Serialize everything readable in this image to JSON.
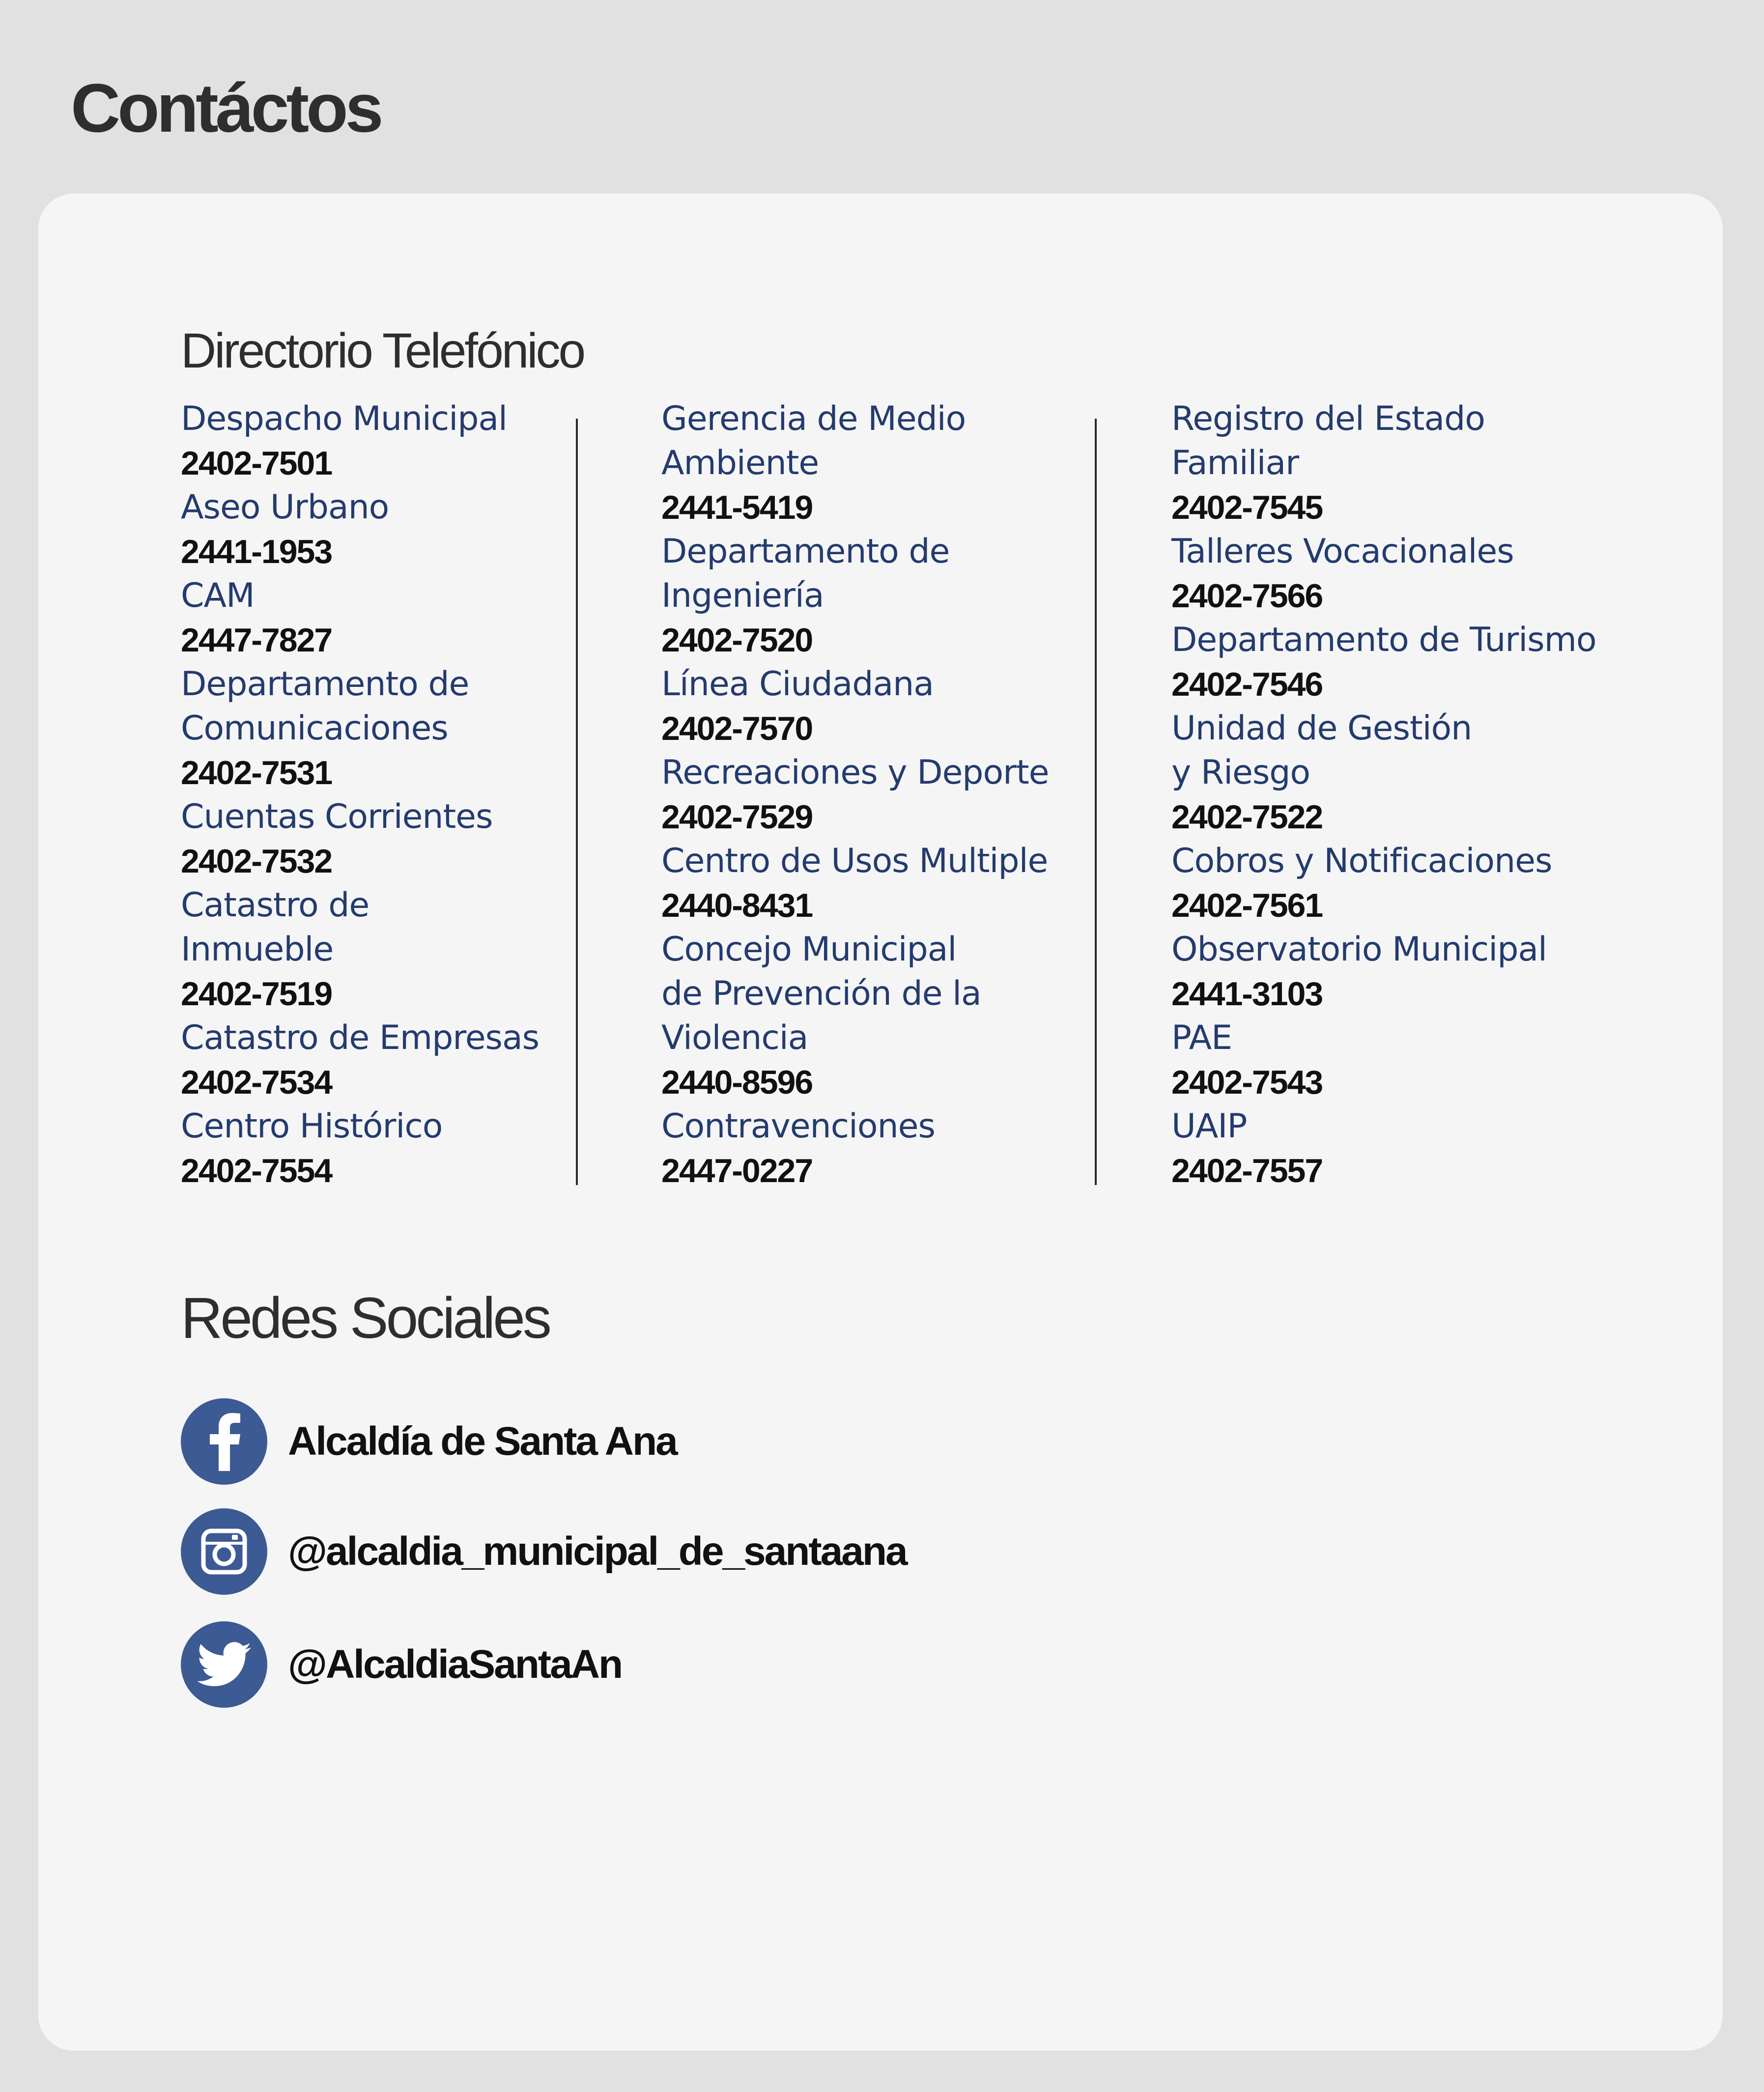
{
  "page": {
    "title": "Contáctos"
  },
  "directory": {
    "title": "Directorio Telefónico",
    "columns": [
      [
        {
          "name": "Despacho Municipal",
          "phone": "2402-7501"
        },
        {
          "name": "Aseo Urbano",
          "phone": "2441-1953"
        },
        {
          "name": "CAM",
          "phone": "2447-7827"
        },
        {
          "name": "Departamento de\nComunicaciones",
          "phone": "2402-7531"
        },
        {
          "name": "Cuentas Corrientes",
          "phone": "2402-7532"
        },
        {
          "name": "Catastro de\nInmueble",
          "phone": "2402-7519"
        },
        {
          "name": "Catastro de Empresas",
          "phone": "2402-7534"
        },
        {
          "name": "Centro Histórico",
          "phone": "2402-7554"
        }
      ],
      [
        {
          "name": "Gerencia de Medio\nAmbiente",
          "phone": "2441-5419"
        },
        {
          "name": "Departamento de\nIngeniería",
          "phone": "2402-7520"
        },
        {
          "name": "Línea Ciudadana",
          "phone": "2402-7570"
        },
        {
          "name": "Recreaciones y Deporte",
          "phone": "2402-7529"
        },
        {
          "name": "Centro de Usos Multiple",
          "phone": "2440-8431"
        },
        {
          "name": "Concejo Municipal\nde Prevención de la\nViolencia",
          "phone": "2440-8596"
        },
        {
          "name": "Contravenciones",
          "phone": "2447-0227"
        }
      ],
      [
        {
          "name": "Registro del Estado\nFamiliar",
          "phone": "2402-7545"
        },
        {
          "name": "Talleres Vocacionales",
          "phone": "2402-7566"
        },
        {
          "name": "Departamento de Turismo",
          "phone": "2402-7546"
        },
        {
          "name": "Unidad de Gestión\ny Riesgo",
          "phone": "2402-7522"
        },
        {
          "name": "Cobros y Notificaciones",
          "phone": "2402-7561"
        },
        {
          "name": "Observatorio Municipal",
          "phone": "2441-3103"
        },
        {
          "name": "PAE",
          "phone": "2402-7543"
        },
        {
          "name": "UAIP",
          "phone": "2402-7557"
        }
      ]
    ]
  },
  "social": {
    "title": "Redes Sociales",
    "facebook": {
      "icon": "facebook-icon",
      "label": "Alcaldía de Santa Ana"
    },
    "instagram": {
      "icon": "instagram-icon",
      "label": "@alcaldia_municipal_de_santaana"
    },
    "twitter": {
      "icon": "twitter-icon",
      "label": "@AlcaldiaSantaAn"
    }
  },
  "colors": {
    "page_background": "#e1e1e1",
    "card_background": "#f5f5f5",
    "entry_name": "#243b6e",
    "phone_text": "#111111",
    "heading": "#2e2e2e",
    "social_icon_bg": "#3c5a93"
  }
}
